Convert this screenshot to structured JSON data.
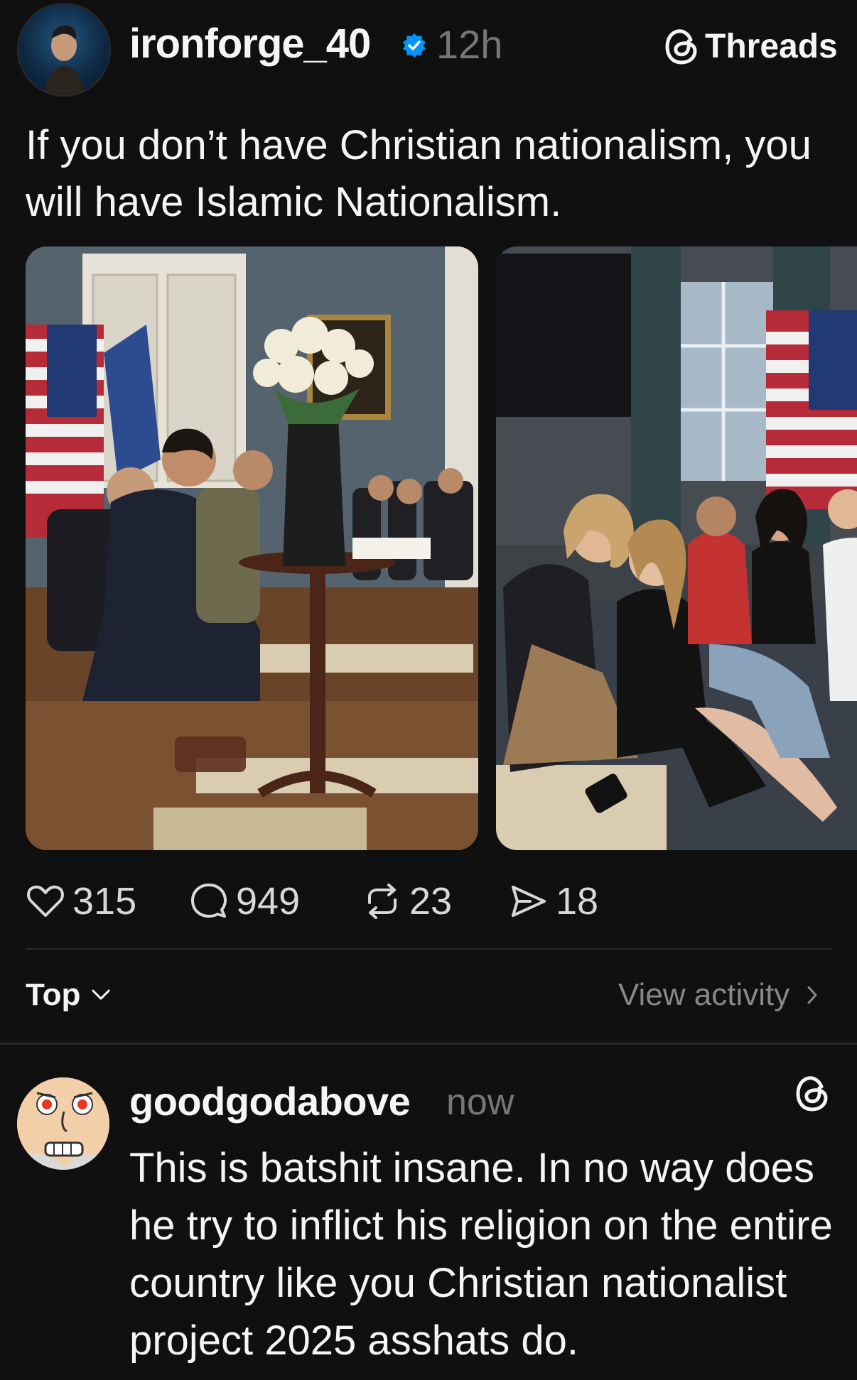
{
  "post": {
    "username": "ironforge_40",
    "time": "12h",
    "brand": "Threads",
    "text": "If you don’t have Christian nationalism, you will have Islamic Nationalism."
  },
  "actions": {
    "likes": "315",
    "comments": "949",
    "reposts": "23",
    "shares": "18"
  },
  "sort": {
    "label": "Top",
    "view_activity": "View activity"
  },
  "reply": {
    "username": "goodgodabove",
    "time": "now",
    "text": "This is batshit insane. In no way does he try to inflict his religion on the entire country like you Christian nationalist project 2025 asshats do."
  },
  "colors": {
    "background": "#101010",
    "verified": "#0095f6",
    "muted": "#777777"
  }
}
